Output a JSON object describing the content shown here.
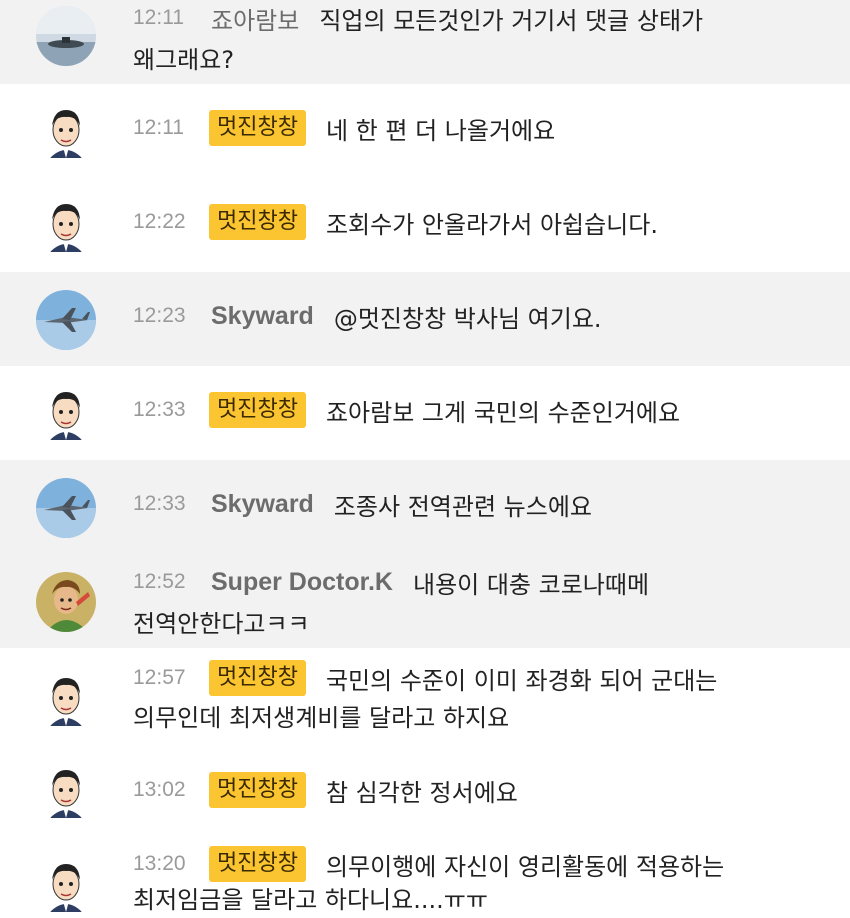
{
  "messages": [
    {
      "time": "12:11",
      "nick": "죠아람보",
      "text": "직업의 모든것인가 거기서 댓글 상태가",
      "cont": "왜그래요?"
    },
    {
      "time": "12:11",
      "nick": "멋진창창",
      "text": "네 한 편 더 나올거에요",
      "cont": ""
    },
    {
      "time": "12:22",
      "nick": "멋진창창",
      "text": "조회수가 안올라가서 아쉽습니다.",
      "cont": ""
    },
    {
      "time": "12:23",
      "nick": "Skyward",
      "text": "@멋진창창 박사님 여기요.",
      "cont": ""
    },
    {
      "time": "12:33",
      "nick": "멋진창창",
      "text": "죠아람보 그게 국민의 수준인거에요",
      "cont": ""
    },
    {
      "time": "12:33",
      "nick": "Skyward",
      "text": "조종사 전역관련 뉴스에요",
      "cont": ""
    },
    {
      "time": "12:52",
      "nick": "Super Doctor.K",
      "text": "내용이 대충 코로나때메",
      "cont": "전역안한다고ㅋㅋ"
    },
    {
      "time": "12:57",
      "nick": "멋진창창",
      "text": "국민의 수준이 이미 좌경화 되어 군대는",
      "cont": "의무인데 최저생계비를 달라고 하지요"
    },
    {
      "time": "13:02",
      "nick": "멋진창창",
      "text": "참 심각한 정서에요",
      "cont": ""
    },
    {
      "time": "13:20",
      "nick": "멋진창창",
      "text": "의무이행에 자신이 영리활동에 적용하는",
      "cont": "최저임금을 달라고 하다니요....ㅠㅠ"
    }
  ],
  "colors": {
    "badge": "#fbc531",
    "alt_row": "#f2f2f2",
    "time": "#9a9a9a",
    "nick": "#6c6c6c"
  }
}
